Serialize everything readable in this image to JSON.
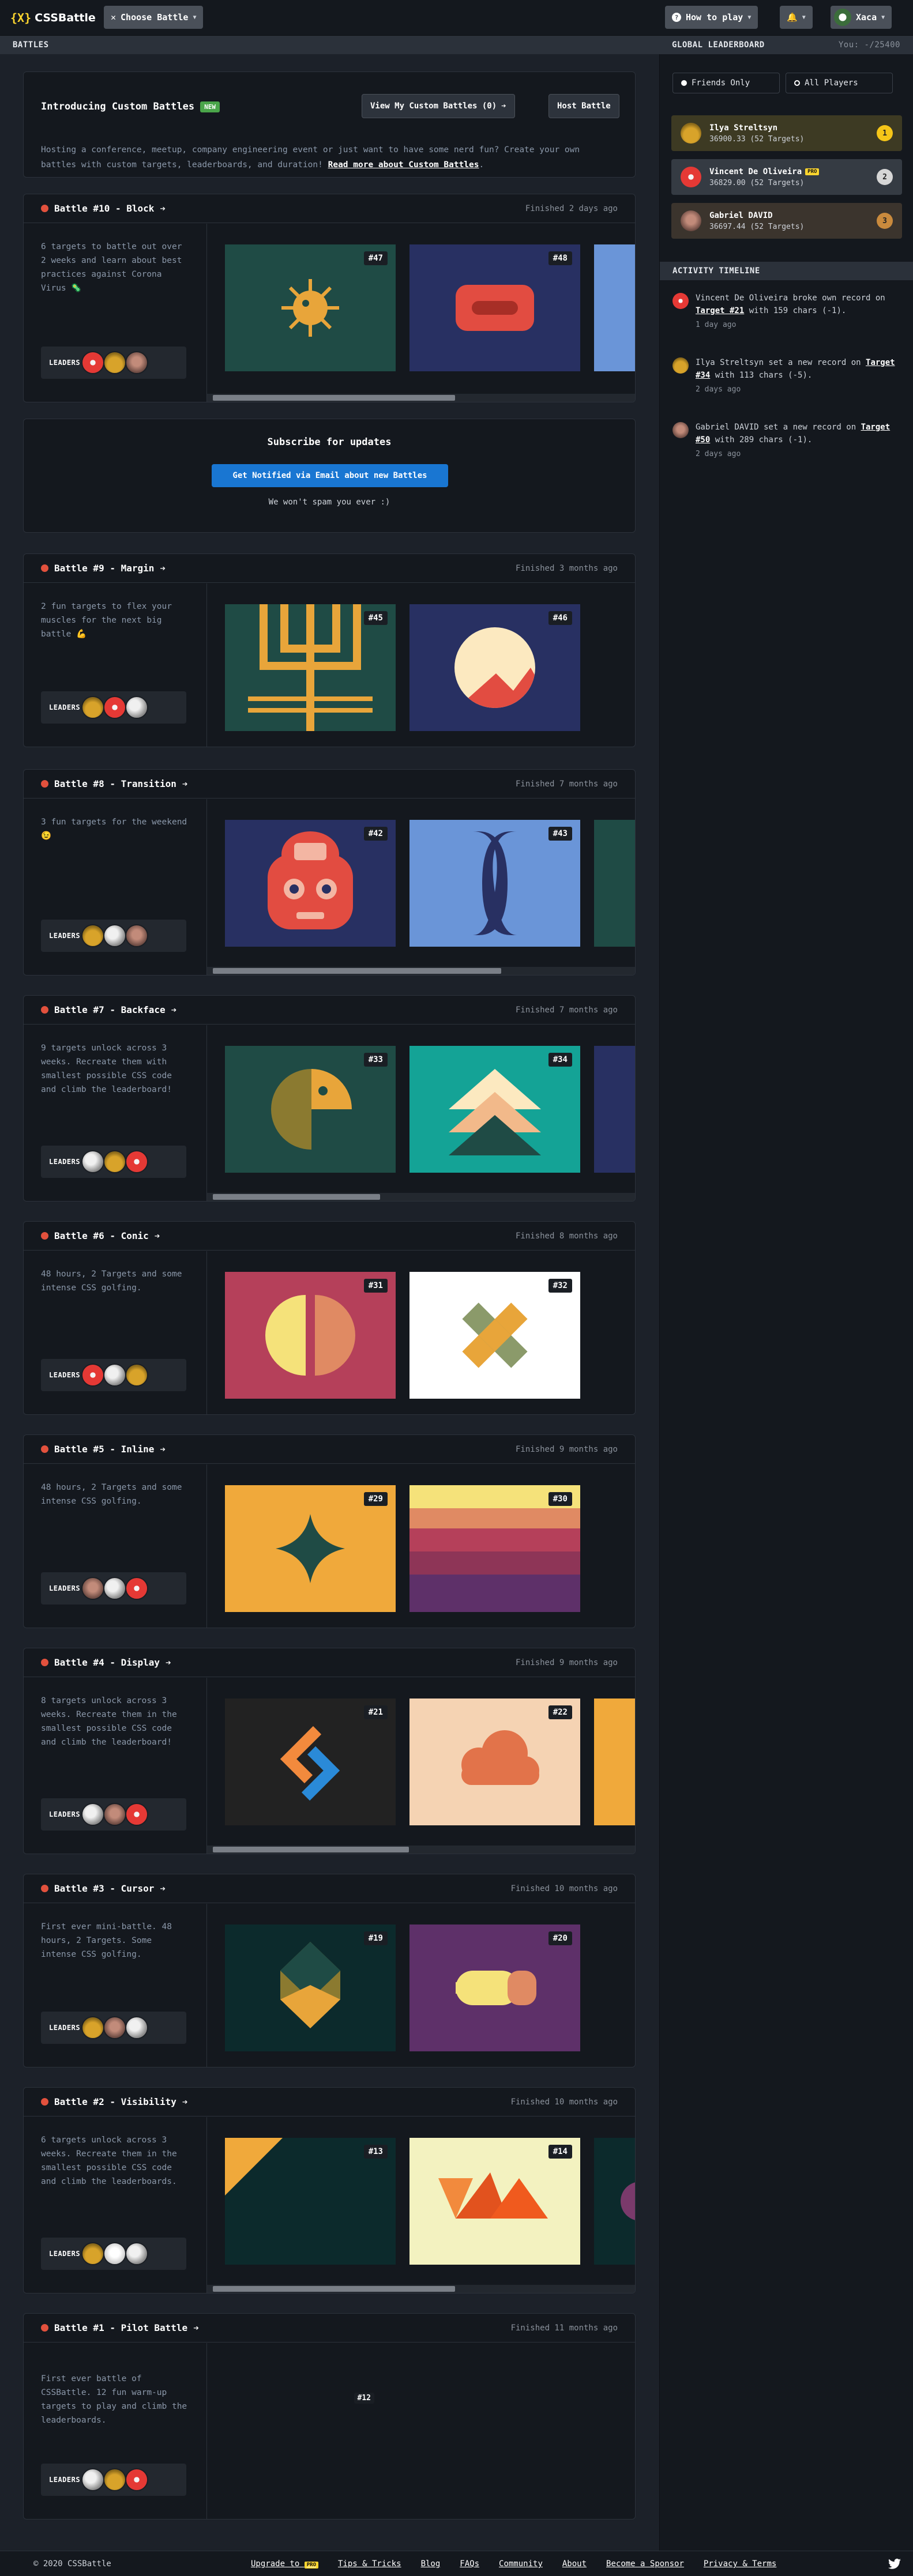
{
  "header": {
    "logo_text": "CSSBattle",
    "logo_brace": "{X}",
    "choose_battle": "Choose Battle",
    "how_to_play": "How to play",
    "user_name": "Xaca"
  },
  "subbar": {
    "battles_label": "BATTLES"
  },
  "leaderboard": {
    "title": "GLOBAL LEADERBOARD",
    "you": "You: -/25400",
    "filter_friends": "Friends Only",
    "filter_all": "All Players",
    "rows": [
      {
        "name": "Ilya Streltsyn",
        "score": "36900.33 (52 Targets)",
        "medal": "1",
        "pro": ""
      },
      {
        "name": "Vincent De Oliveira",
        "score": "36829.00 (52 Targets)",
        "medal": "2",
        "pro": "PRO"
      },
      {
        "name": "Gabriel DAVID",
        "score": "36697.44 (52 Targets)",
        "medal": "3",
        "pro": ""
      }
    ]
  },
  "activity": {
    "title": "ACTIVITY TIMELINE",
    "items": [
      {
        "pre": "Vincent De Oliveira broke own record on ",
        "target": "Target #21",
        "post": " with 159 chars (-1).",
        "time": "1 day ago"
      },
      {
        "pre": "Ilya Streltsyn set a new record on ",
        "target": "Target #34",
        "post": " with 113 chars (-5).",
        "time": "2 days ago"
      },
      {
        "pre": "Gabriel DAVID set a new record on ",
        "target": "Target #50",
        "post": " with 289 chars (-1).",
        "time": "2 days ago"
      }
    ]
  },
  "intro": {
    "title": "Introducing Custom Battles",
    "badge": "NEW",
    "view_button": "View My Custom Battles (0)",
    "host_button": "Host Battle",
    "text": "Hosting a conference, meetup, company engineering event or just want to have some nerd fun? Create your own battles with custom targets, leaderboards, and duration! ",
    "link": "Read more about Custom Battles",
    "text_end": "."
  },
  "subscribe": {
    "title": "Subscribe for updates",
    "button": "Get Notified via Email about new Battles",
    "note": "We won't spam you ever :)"
  },
  "leaders_label": "LEADERS",
  "battles": [
    {
      "title": "Battle #10 - Block",
      "finished": "Finished 2 days ago",
      "desc": "6 targets to battle out over 2 weeks and learn about best practices against Corona Virus 🦠",
      "targets": [
        "#47",
        "#48"
      ]
    },
    {
      "title": "Battle #9 - Margin",
      "finished": "Finished 3 months ago",
      "desc": "2 fun targets to flex your muscles for the next big battle 💪",
      "targets": [
        "#45",
        "#46"
      ]
    },
    {
      "title": "Battle #8 - Transition",
      "finished": "Finished 7 months ago",
      "desc": "3 fun targets for the weekend 😉",
      "targets": [
        "#42",
        "#43"
      ]
    },
    {
      "title": "Battle #7 - Backface",
      "finished": "Finished 7 months ago",
      "desc": "9 targets unlock across 3 weeks. Recreate them with smallest possible CSS code and climb the leaderboard!",
      "targets": [
        "#33",
        "#34"
      ]
    },
    {
      "title": "Battle #6 - Conic",
      "finished": "Finished 8 months ago",
      "desc": "48 hours, 2 Targets and some intense CSS golfing.",
      "targets": [
        "#31",
        "#32"
      ]
    },
    {
      "title": "Battle #5 - Inline",
      "finished": "Finished 9 months ago",
      "desc": "48 hours, 2 Targets and some intense CSS golfing.",
      "targets": [
        "#29",
        "#30"
      ]
    },
    {
      "title": "Battle #4 - Display",
      "finished": "Finished 9 months ago",
      "desc": "8 targets unlock across 3 weeks. Recreate them in the smallest possible CSS code and climb the leaderboard!",
      "targets": [
        "#21",
        "#22"
      ]
    },
    {
      "title": "Battle #3 - Cursor",
      "finished": "Finished 10 months ago",
      "desc": "First ever mini-battle. 48 hours, 2 Targets. Some intense CSS golfing.",
      "targets": [
        "#19",
        "#20"
      ]
    },
    {
      "title": "Battle #2 - Visibility",
      "finished": "Finished 10 months ago",
      "desc": "6 targets unlock across 3 weeks. Recreate them in the smallest possible CSS code and climb the leaderboards.",
      "targets": [
        "#13",
        "#14"
      ]
    },
    {
      "title": "Battle #1 - Pilot Battle",
      "finished": "Finished 11 months ago",
      "desc": "First ever battle of CSSBattle. 12 fun warm-up targets to play and climb the leaderboards.",
      "targets": [
        "#12"
      ]
    }
  ],
  "footer": {
    "copy": "© 2020 CSSBattle",
    "upgrade": "Upgrade to",
    "pro_badge": "PRO",
    "links": [
      "Tips & Tricks",
      "Blog",
      "FAQs",
      "Community",
      "About",
      "Become a Sponsor",
      "Privacy & Terms"
    ]
  }
}
